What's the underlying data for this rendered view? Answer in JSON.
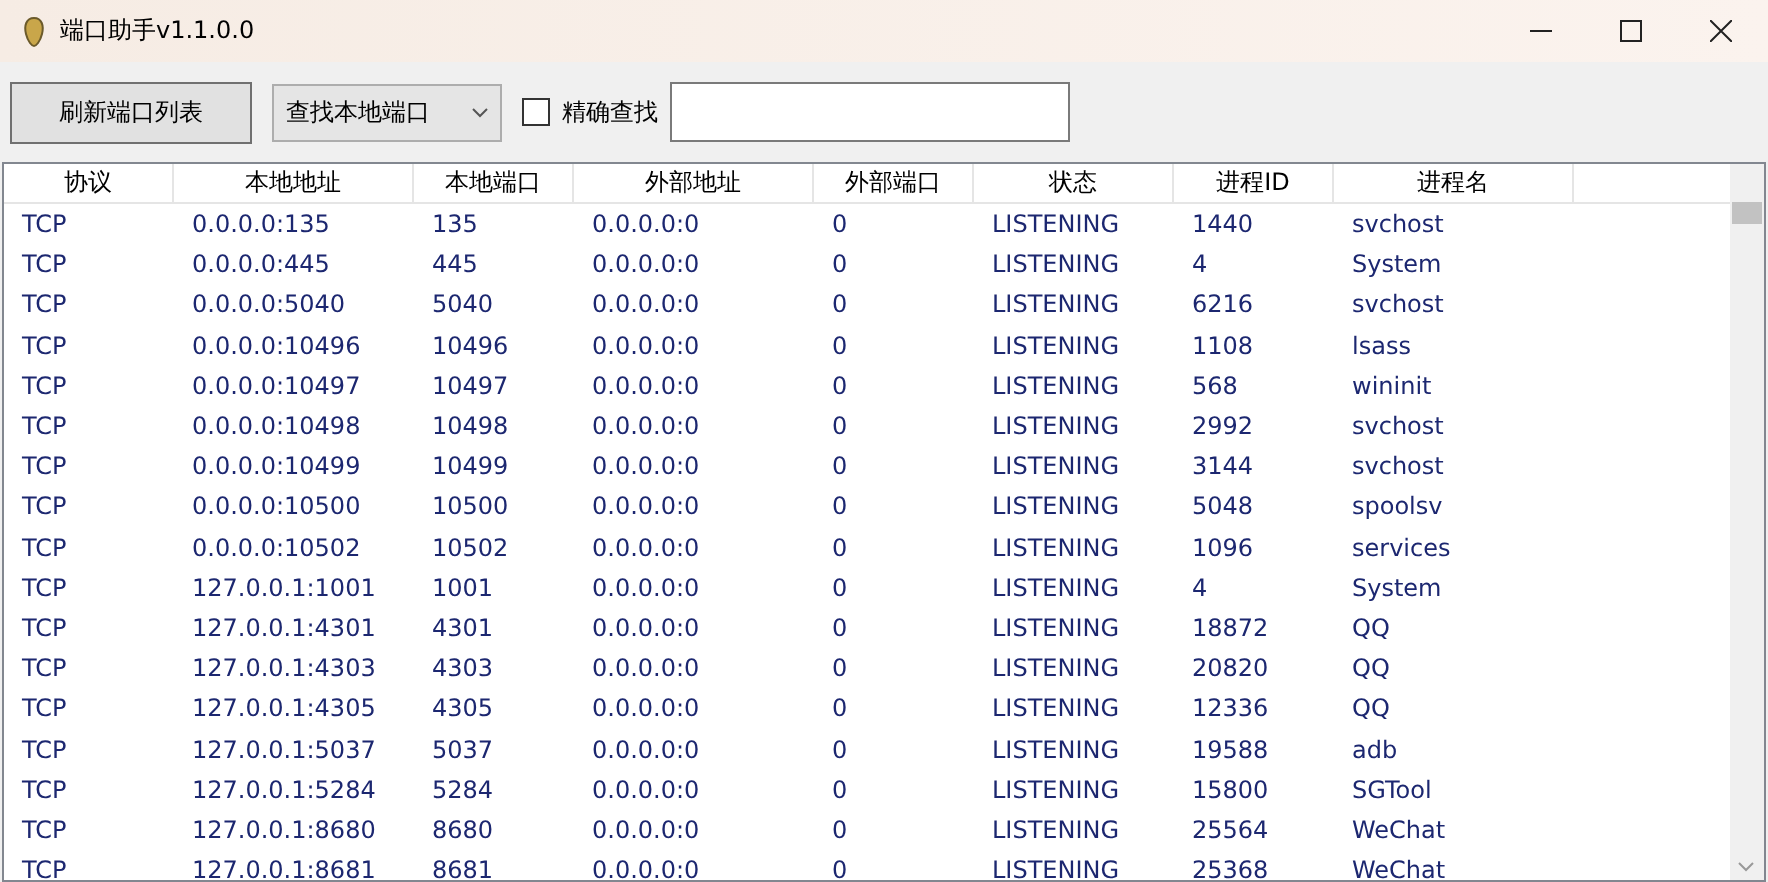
{
  "window": {
    "title": "端口助手v1.1.0.0"
  },
  "toolbar": {
    "refresh_button": "刷新端口列表",
    "search_mode": "查找本地端口",
    "exact_match": {
      "label": "精确查找",
      "checked": false
    }
  },
  "table": {
    "columns": [
      "协议",
      "本地地址",
      "本地端口",
      "外部地址",
      "外部端口",
      "状态",
      "进程ID",
      "进程名"
    ],
    "rows": [
      [
        "TCP",
        "0.0.0.0:135",
        "135",
        "0.0.0.0:0",
        "0",
        "LISTENING",
        "1440",
        "svchost"
      ],
      [
        "TCP",
        "0.0.0.0:445",
        "445",
        "0.0.0.0:0",
        "0",
        "LISTENING",
        "4",
        "System"
      ],
      [
        "TCP",
        "0.0.0.0:5040",
        "5040",
        "0.0.0.0:0",
        "0",
        "LISTENING",
        "6216",
        "svchost"
      ],
      [
        "TCP",
        "0.0.0.0:10496",
        "10496",
        "0.0.0.0:0",
        "0",
        "LISTENING",
        "1108",
        "lsass"
      ],
      [
        "TCP",
        "0.0.0.0:10497",
        "10497",
        "0.0.0.0:0",
        "0",
        "LISTENING",
        "568",
        "wininit"
      ],
      [
        "TCP",
        "0.0.0.0:10498",
        "10498",
        "0.0.0.0:0",
        "0",
        "LISTENING",
        "2992",
        "svchost"
      ],
      [
        "TCP",
        "0.0.0.0:10499",
        "10499",
        "0.0.0.0:0",
        "0",
        "LISTENING",
        "3144",
        "svchost"
      ],
      [
        "TCP",
        "0.0.0.0:10500",
        "10500",
        "0.0.0.0:0",
        "0",
        "LISTENING",
        "5048",
        "spoolsv"
      ],
      [
        "TCP",
        "0.0.0.0:10502",
        "10502",
        "0.0.0.0:0",
        "0",
        "LISTENING",
        "1096",
        "services"
      ],
      [
        "TCP",
        "127.0.0.1:1001",
        "1001",
        "0.0.0.0:0",
        "0",
        "LISTENING",
        "4",
        "System"
      ],
      [
        "TCP",
        "127.0.0.1:4301",
        "4301",
        "0.0.0.0:0",
        "0",
        "LISTENING",
        "18872",
        "QQ"
      ],
      [
        "TCP",
        "127.0.0.1:4303",
        "4303",
        "0.0.0.0:0",
        "0",
        "LISTENING",
        "20820",
        "QQ"
      ],
      [
        "TCP",
        "127.0.0.1:4305",
        "4305",
        "0.0.0.0:0",
        "0",
        "LISTENING",
        "12336",
        "QQ"
      ],
      [
        "TCP",
        "127.0.0.1:5037",
        "5037",
        "0.0.0.0:0",
        "0",
        "LISTENING",
        "19588",
        "adb"
      ],
      [
        "TCP",
        "127.0.0.1:5284",
        "5284",
        "0.0.0.0:0",
        "0",
        "LISTENING",
        "15800",
        "SGTool"
      ],
      [
        "TCP",
        "127.0.0.1:8680",
        "8680",
        "0.0.0.0:0",
        "0",
        "LISTENING",
        "25564",
        "WeChat"
      ],
      [
        "TCP",
        "127.0.0.1:8681",
        "8681",
        "0.0.0.0:0",
        "0",
        "LISTENING",
        "25368",
        "WeChat"
      ]
    ]
  }
}
